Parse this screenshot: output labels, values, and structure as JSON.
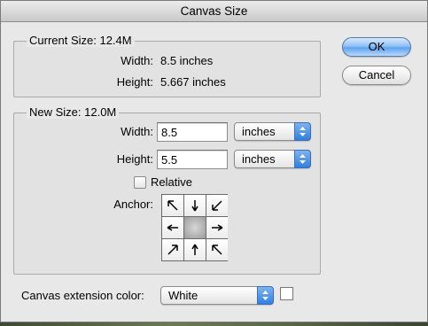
{
  "window": {
    "title": "Canvas Size"
  },
  "current_size": {
    "label": "Current Size: 12.4M",
    "width_label": "Width:",
    "width_value": "8.5 inches",
    "height_label": "Height:",
    "height_value": "5.667 inches"
  },
  "new_size": {
    "label": "New Size: 12.0M",
    "width_label": "Width:",
    "width_value": "8.5",
    "width_unit": "inches",
    "height_label": "Height:",
    "height_value": "5.5",
    "height_unit": "inches",
    "relative_label": "Relative",
    "relative_checked": false,
    "anchor_label": "Anchor:",
    "anchor_selected": "center"
  },
  "extension": {
    "label": "Canvas extension color:",
    "value": "White",
    "swatch_color": "#ffffff"
  },
  "buttons": {
    "ok": "OK",
    "cancel": "Cancel"
  },
  "colors": {
    "accent": "#5ea3ef"
  }
}
